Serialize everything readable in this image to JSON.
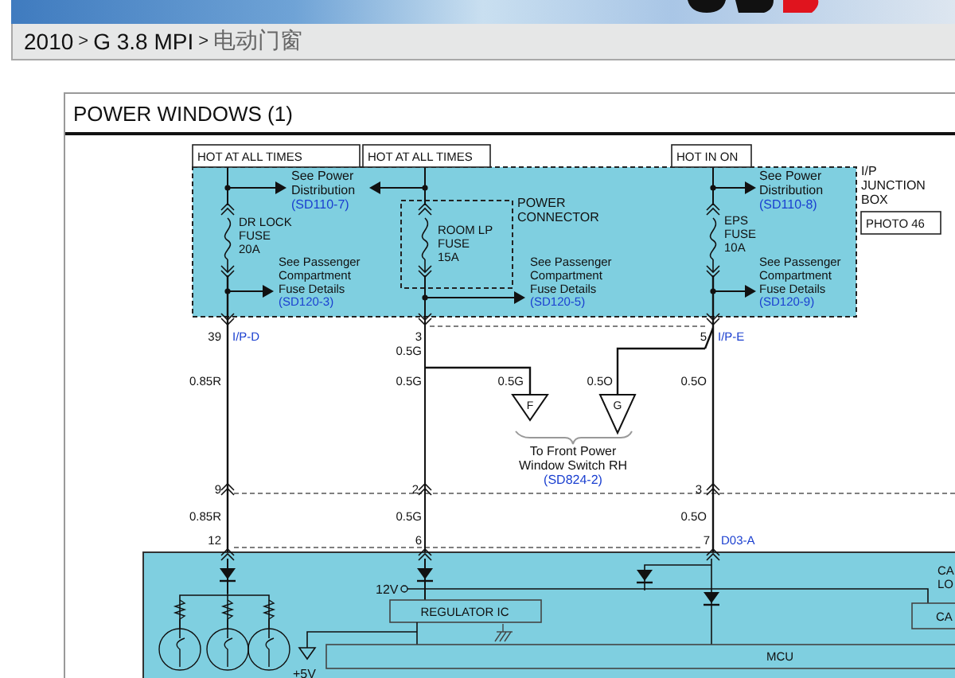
{
  "breadcrumb": {
    "items": [
      "2010",
      "G 3.8 MPI",
      "电动门窗"
    ],
    "separator": ">"
  },
  "panel": {
    "title": "POWER WINDOWS (1)"
  },
  "diagram": {
    "power_sources": [
      "HOT AT ALL TIMES",
      "HOT AT ALL TIMES",
      "HOT IN ON"
    ],
    "fuses": [
      {
        "lines": [
          "DR LOCK",
          "FUSE",
          "20A"
        ]
      },
      {
        "lines": [
          "ROOM LP",
          "FUSE",
          "15A"
        ]
      },
      {
        "lines": [
          "EPS",
          "FUSE",
          "10A"
        ]
      }
    ],
    "references": [
      {
        "lines": [
          "See Power",
          "Distribution"
        ],
        "code": "(SD110-7)"
      },
      {
        "lines": [
          "See Power",
          "Distribution"
        ],
        "code": "(SD110-8)"
      },
      {
        "lines": [
          "See Passenger",
          "Compartment",
          "Fuse Details"
        ],
        "code": "(SD120-3)"
      },
      {
        "lines": [
          "See Passenger",
          "Compartment",
          "Fuse Details"
        ],
        "code": "(SD120-5)"
      },
      {
        "lines": [
          "See Passenger",
          "Compartment",
          "Fuse Details"
        ],
        "code": "(SD120-9)"
      }
    ],
    "power_connector": [
      "POWER",
      "CONNECTOR"
    ],
    "junction_box": {
      "lines": [
        "I/P",
        "JUNCTION",
        "BOX"
      ],
      "photo": "PHOTO 46"
    },
    "connector_pins": [
      {
        "pin": "39",
        "connector": "I/P-D"
      },
      {
        "pin": "3"
      },
      {
        "pin": "5",
        "connector": "I/P-E"
      },
      {
        "pin": "9"
      },
      {
        "pin": "2"
      },
      {
        "pin": "3"
      },
      {
        "pin": "12"
      },
      {
        "pin": "6"
      },
      {
        "pin": "7",
        "connector": "D03-A"
      }
    ],
    "wire_labels": [
      "0.5G",
      "0.85R",
      "0.5G",
      "0.5G",
      "0.5O",
      "0.5O",
      "0.85R",
      "0.5G",
      "0.5O"
    ],
    "switch_terminals": [
      "F",
      "G"
    ],
    "switch_note": {
      "lines": [
        "To Front Power",
        "Window Switch RH"
      ],
      "code": "(SD824-2)"
    },
    "module": {
      "supply": "12V",
      "regulator": "REGULATOR IC",
      "ref_voltage": "+5V",
      "mcu": "MCU",
      "edge_labels": [
        "CA",
        "LO"
      ],
      "edge_box": "CA"
    }
  }
}
